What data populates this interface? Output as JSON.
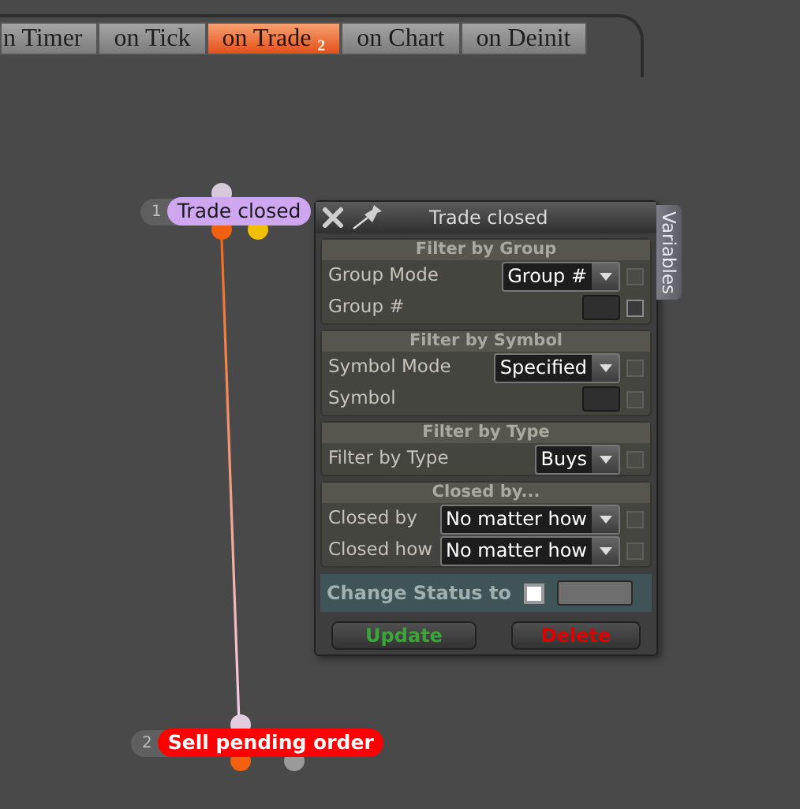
{
  "tabs": [
    {
      "label": "n Timer",
      "selected": false
    },
    {
      "label": "on Tick",
      "selected": false
    },
    {
      "label": "on Trade",
      "count": "2",
      "selected": true
    },
    {
      "label": "on Chart",
      "selected": false
    },
    {
      "label": "on Deinit",
      "selected": false
    }
  ],
  "nodes": [
    {
      "number": "1",
      "label": "Trade closed",
      "color": "#cfa6f0"
    },
    {
      "number": "2",
      "label": "Sell pending order",
      "color": "#ff0000"
    }
  ],
  "dialog": {
    "title": "Trade closed",
    "side_tab": "Variables",
    "sections": [
      {
        "title": "Filter by Group",
        "rows": [
          {
            "label": "Group Mode",
            "kind": "select",
            "value": "Group #",
            "disabled": true
          },
          {
            "label": "Group #",
            "kind": "input",
            "disabled": false
          }
        ]
      },
      {
        "title": "Filter by Symbol",
        "rows": [
          {
            "label": "Symbol Mode",
            "kind": "select",
            "value": "Specified",
            "disabled": true
          },
          {
            "label": "Symbol",
            "kind": "input",
            "disabled": true
          }
        ]
      },
      {
        "title": "Filter by Type",
        "rows": [
          {
            "label": "Filter by Type",
            "kind": "select",
            "value": "Buys",
            "disabled": true
          }
        ]
      },
      {
        "title": "Closed by...",
        "rows": [
          {
            "label": "Closed by",
            "kind": "select",
            "value": "No matter how",
            "disabled": true
          },
          {
            "label": "Closed how",
            "kind": "select",
            "value": "No matter how",
            "disabled": true
          }
        ]
      }
    ],
    "change_status": {
      "label": "Change Status to",
      "checked": false
    },
    "buttons": [
      {
        "label": "Update",
        "kind": "update"
      },
      {
        "label": "Delete",
        "kind": "delete"
      }
    ]
  }
}
